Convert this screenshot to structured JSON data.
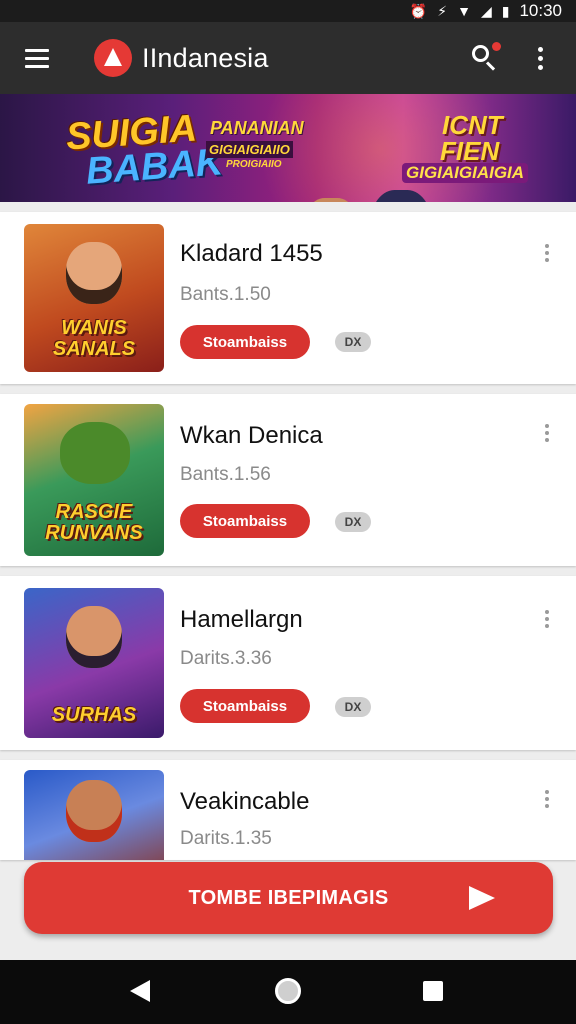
{
  "status_bar": {
    "time": "10:30",
    "icons": [
      "alarm-icon",
      "vibrate-icon",
      "wifi-icon",
      "signal-icon",
      "battery-icon"
    ]
  },
  "app_bar": {
    "title": "IIndanesia",
    "logo_icon": "app-logo-icon",
    "actions": [
      "search-icon",
      "more-vert-icon"
    ],
    "brand_color": "#e53935"
  },
  "banner": {
    "line1": "SUIGIA",
    "line2": "BABAK",
    "line3": "PANANIAN",
    "line4": "GIGIAIGIAIIO",
    "line5": "PROIGIAIIO",
    "line6": "ICNT",
    "line7": "FIEN",
    "line8": "GIGIAIGIAIGIA"
  },
  "games": [
    {
      "name": "Kladard 1455",
      "meta": "Bants.1.50",
      "button": "Stoambaiss",
      "tag": "DX",
      "art": "WANIS SANALS"
    },
    {
      "name": "Wkan Denica",
      "meta": "Bants.1.56",
      "button": "Stoambaiss",
      "tag": "DX",
      "art": "RASGIE RUNVANS"
    },
    {
      "name": "Hamellargn",
      "meta": "Darits.3.36",
      "button": "Stoambaiss",
      "tag": "DX",
      "art": "SURHAS"
    },
    {
      "name": "Veakincable",
      "meta": "Darits.1.35"
    }
  ],
  "cta": {
    "label": "TOMBE IBEPIMAGIS",
    "icon": "play-arrow-icon"
  },
  "nav": [
    "back-icon",
    "home-icon",
    "recents-icon"
  ],
  "colors": {
    "accent": "#d7332f",
    "app_bar": "#2d2d2d",
    "background": "#ededed"
  }
}
